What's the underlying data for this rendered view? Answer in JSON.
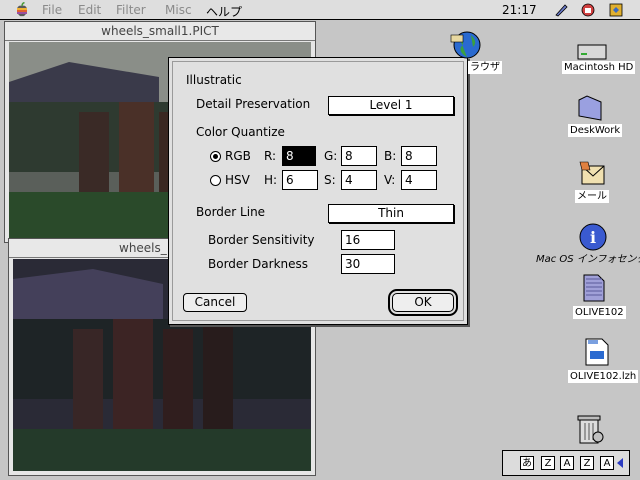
{
  "menubar": {
    "items": [
      "File",
      "Edit",
      "Filter",
      "Misc",
      "ヘルプ"
    ],
    "clock": "21:17"
  },
  "windows": {
    "back_title": "wheels_small1.PICT",
    "front_title": "wheels_"
  },
  "dialog": {
    "title": "Illustratic",
    "detail_label": "Detail Preservation",
    "detail_value": "Level 1",
    "color_quantize_label": "Color Quantize",
    "rgb_label": "RGB",
    "hsv_label": "HSV",
    "r_label": "R:",
    "r_value": "8",
    "g_label": "G:",
    "g_value": "8",
    "b_label": "B:",
    "b_value": "8",
    "h_label": "H:",
    "h_value": "6",
    "s_label": "S:",
    "s_value": "4",
    "v_label": "V:",
    "v_value": "4",
    "border_line_label": "Border Line",
    "border_line_value": "Thin",
    "sensitivity_label": "Border Sensitivity",
    "sensitivity_value": "16",
    "darkness_label": "Border Darkness",
    "darkness_value": "30",
    "cancel_label": "Cancel",
    "ok_label": "OK"
  },
  "desktop": {
    "browser_label": "ラウザ",
    "hd_label": "Macintosh HD",
    "deskwork_label": "DeskWork",
    "mail_label": "メール",
    "macos_info_label": "Mac OS インフォセンタ",
    "olive_label": "OLIVE102",
    "olive_lzh_label": "OLIVE102.lzh"
  },
  "palette": {
    "buttons": [
      "あ",
      "Z",
      "A",
      "Z",
      "A"
    ]
  }
}
